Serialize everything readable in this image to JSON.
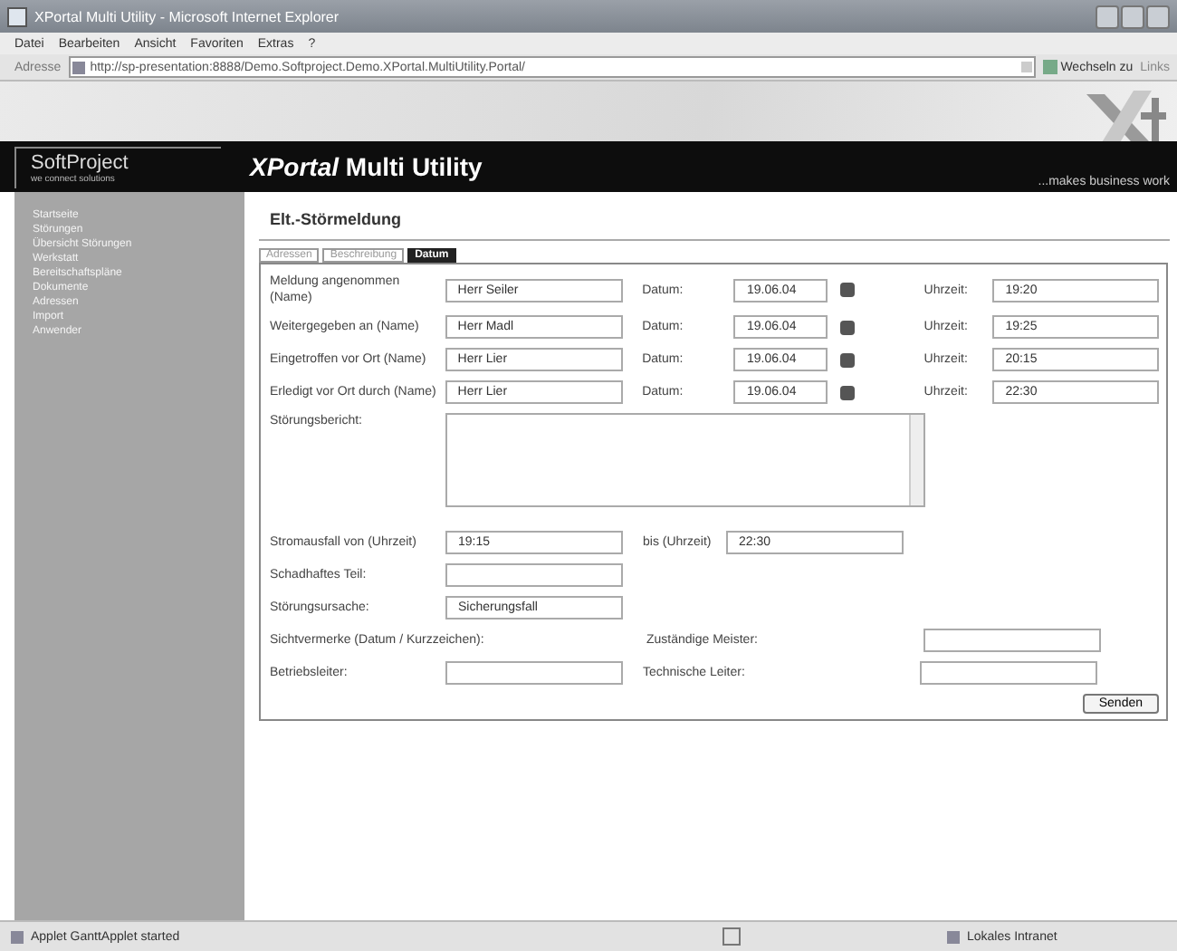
{
  "window": {
    "title": "XPortal Multi Utility - Microsoft Internet Explorer"
  },
  "menu": [
    "Datei",
    "Bearbeiten",
    "Ansicht",
    "Favoriten",
    "Extras",
    "?"
  ],
  "address_bar": {
    "label": "Adresse",
    "url": "http://sp-presentation:8888/Demo.Softproject.Demo.XPortal.MultiUtility.Portal/",
    "go_label": "Wechseln zu",
    "links_label": "Links"
  },
  "header": {
    "logo_name": "SoftProject",
    "logo_tagline": "we connect solutions",
    "app_title": "*XPortal*  Multi Utility",
    "slogan": "...makes business work"
  },
  "sidebar": {
    "items": [
      "Startseite",
      "Störungen",
      "Übersicht Störungen",
      "Werkstatt",
      "Bereitschaftspläne",
      "Dokumente",
      "Adressen",
      "Import",
      "Anwender"
    ]
  },
  "page_title": "Elt.-Störmeldung",
  "tabs": [
    {
      "label": "Adressen",
      "selected": false
    },
    {
      "label": "Beschreibung",
      "selected": false
    },
    {
      "label": "Datum",
      "selected": true
    }
  ],
  "form": {
    "rows": [
      {
        "label": "Meldung angenommen (Name)",
        "name": "Herr Seiler",
        "date_label": "Datum:",
        "date": "19.06.04",
        "time_label": "Uhrzeit:",
        "time": "19:20"
      },
      {
        "label": "Weitergegeben an (Name)",
        "name": "Herr Madl",
        "date_label": "Datum:",
        "date": "19.06.04",
        "time_label": "Uhrzeit:",
        "time": "19:25"
      },
      {
        "label": "Eingetroffen vor Ort (Name)",
        "name": "Herr Lier",
        "date_label": "Datum:",
        "date": "19.06.04",
        "time_label": "Uhrzeit:",
        "time": "20:15"
      },
      {
        "label": "Erledigt vor Ort durch (Name)",
        "name": "Herr Lier",
        "date_label": "Datum:",
        "date": "19.06.04",
        "time_label": "Uhrzeit:",
        "time": "22:30"
      }
    ],
    "report_label": "Störungsbericht:",
    "outage": {
      "label": "Stromausfall von (Uhrzeit)",
      "from": "19:15",
      "to_label": "bis (Uhrzeit)",
      "to": "22:30"
    },
    "defect_label": "Schadhaftes Teil:",
    "cause": {
      "label": "Störungsursache:",
      "value": "Sicherungsfall"
    },
    "signoff_label": "Sichtvermerke (Datum / Kurzzeichen):",
    "master_label": "Zuständige Meister:",
    "manager_label": "Betriebsleiter:",
    "tech_label": "Technische Leiter:",
    "submit": "Senden"
  },
  "status_bar": {
    "text": "Applet GanttApplet started",
    "zone": "Lokales Intranet"
  }
}
